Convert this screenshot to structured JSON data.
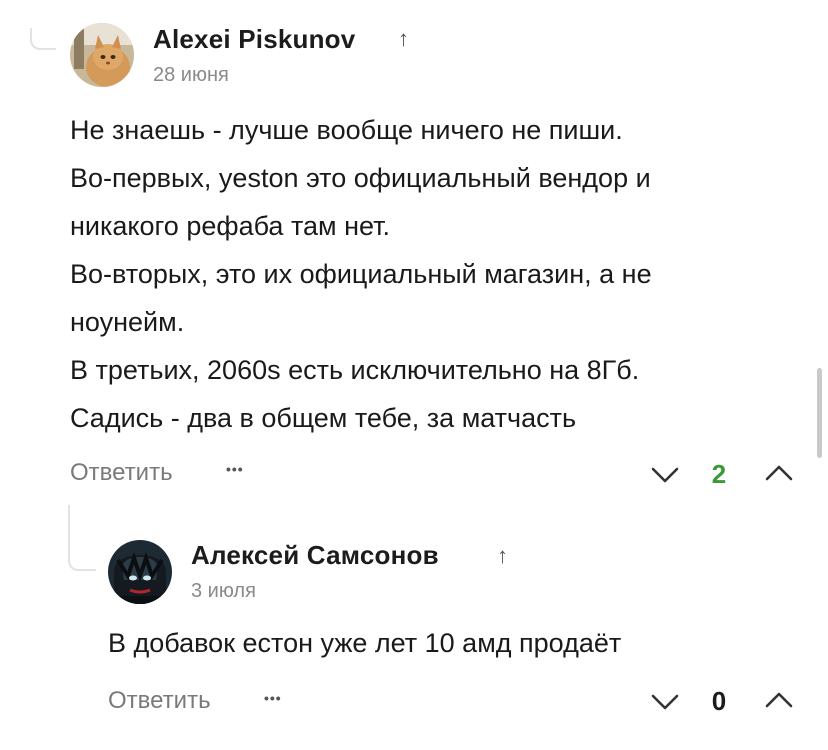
{
  "comments": [
    {
      "author": "Alexei Piskunov",
      "author_marker": "↑",
      "date": "28 июня",
      "avatar": "cat-avatar",
      "lines": [
        "Не знаешь - лучше вообще ничего не пиши.",
        "Во-первых, yeston это официальный вендор и",
        "никакого рефаба там нет.",
        "Во-вторых, это их официальный магазин, а не",
        "ноунейм.",
        "В третьих, 2060s есть исключительно на 8Гб.",
        "Садись - два в общем тебе, за матчасть"
      ],
      "reply_label": "Ответить",
      "more_label": "•••",
      "rating": "2",
      "rating_color": "#3a9a3a"
    },
    {
      "author": "Алексей Самсонов",
      "author_marker": "↑",
      "date": "3 июля",
      "avatar": "dark-character-avatar",
      "lines": [
        "В добавок естон уже лет 10 амд продаёт"
      ],
      "reply_label": "Ответить",
      "more_label": "•••",
      "rating": "0",
      "rating_color": "#1b1b1b"
    }
  ]
}
